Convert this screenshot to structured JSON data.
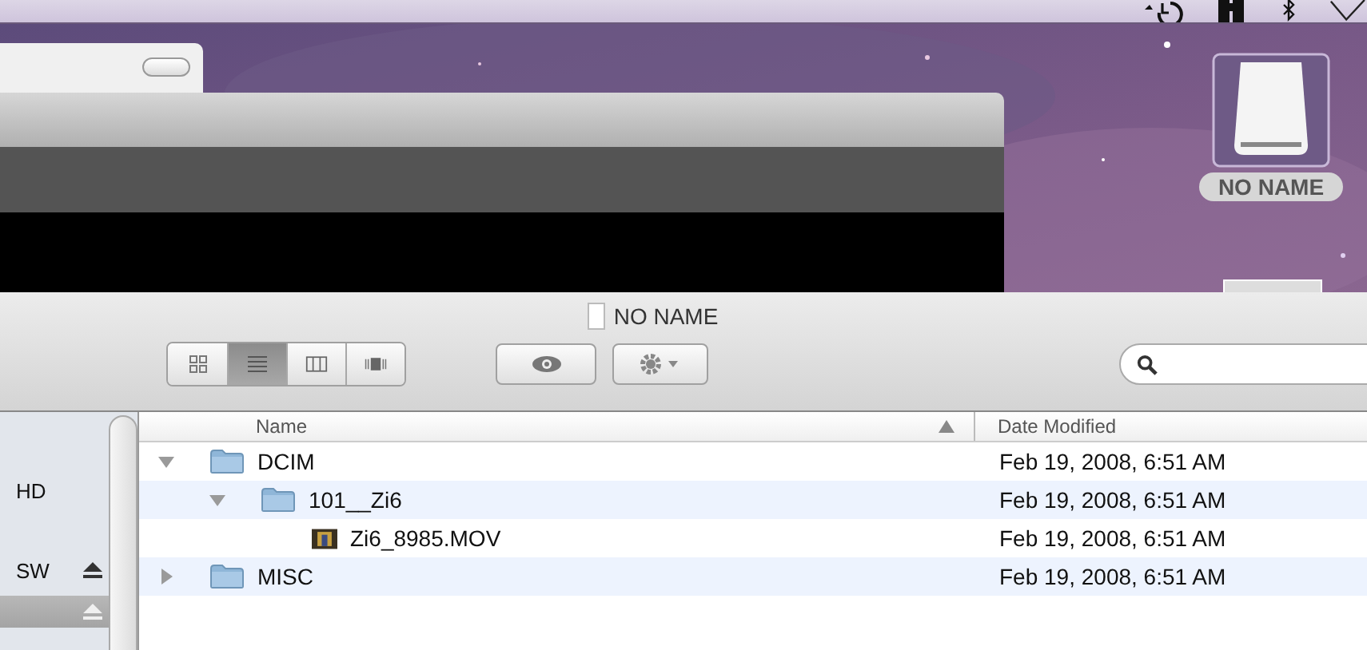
{
  "desktop_icon": {
    "label": "NO NAME"
  },
  "finder": {
    "title": "NO NAME",
    "view_buttons": [
      {
        "kind": "icon",
        "selected": false
      },
      {
        "kind": "list",
        "selected": true
      },
      {
        "kind": "columns",
        "selected": false
      },
      {
        "kind": "coverflow",
        "selected": false
      }
    ],
    "sidebar": {
      "items": [
        {
          "label": "HD",
          "eject": false,
          "selected": false
        },
        {
          "label": "SW",
          "eject": true,
          "selected": false
        },
        {
          "eject": true,
          "selected": true
        }
      ]
    },
    "columns": [
      {
        "label": "Name",
        "sorted": true
      },
      {
        "label": "Date Modified",
        "sorted": false
      }
    ],
    "rows": [
      {
        "name": "DCIM",
        "kind": "folder",
        "date": "Feb 19, 2008, 6:51 AM",
        "expanded": true,
        "children": [
          {
            "name": "101__Zi6",
            "kind": "folder",
            "date": "Feb 19, 2008, 6:51 AM",
            "expanded": true,
            "children": [
              {
                "name": "Zi6_8985.MOV",
                "kind": "movie",
                "date": "Feb 19, 2008, 6:51 AM"
              }
            ]
          }
        ]
      },
      {
        "name": "MISC",
        "kind": "folder",
        "date": "Feb 19, 2008, 6:51 AM",
        "expanded": false
      }
    ]
  }
}
